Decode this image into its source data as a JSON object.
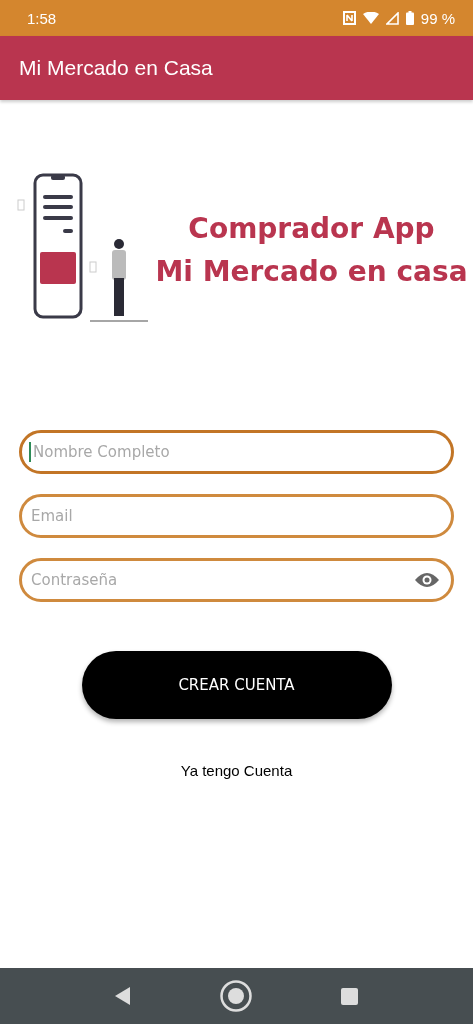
{
  "status_bar": {
    "time": "1:58",
    "battery": "99 %"
  },
  "app_bar": {
    "title": "Mi Mercado en Casa"
  },
  "banner": {
    "lines": [
      "Comprador App",
      "Mi Mercado en casa"
    ]
  },
  "fields": [
    {
      "kind": "text",
      "placeholder": "Nombre Completo",
      "focused": true
    },
    {
      "kind": "email",
      "placeholder": "Email",
      "focused": false
    },
    {
      "kind": "password",
      "placeholder": "Contraseña",
      "focused": false
    }
  ],
  "primary_button": {
    "label": "CREAR CUENTA"
  },
  "link": {
    "label": "Ya tengo Cuenta"
  }
}
